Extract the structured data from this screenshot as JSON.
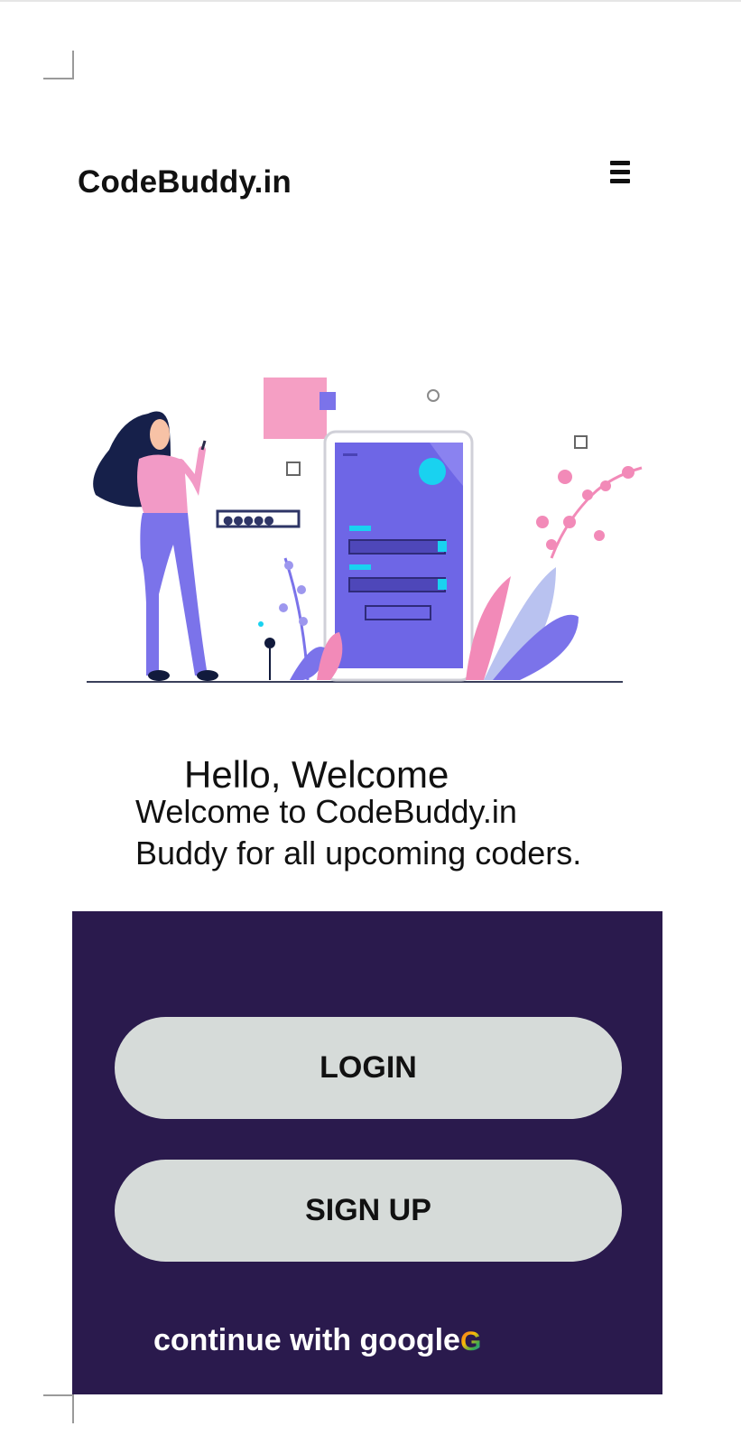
{
  "header": {
    "brand": "CodeBuddy.in",
    "menu_icon": "hamburger-menu-icon"
  },
  "hero": {
    "illustration": "woman-with-phone-login-illustration",
    "password_dots": "●●●●●"
  },
  "welcome": {
    "title": "Hello, Welcome",
    "line1": "Welcome to CodeBuddy.in",
    "line2": "Buddy for all upcoming coders."
  },
  "auth": {
    "login_label": "LOGIN",
    "signup_label": "SIGN UP",
    "google_text": "continue with google",
    "google_icon_letter": "G"
  },
  "colors": {
    "panel_bg": "#2a1a4d",
    "button_bg": "#d6dbd9",
    "phone_screen": "#6e66e6",
    "accent_pink": "#f29ac6",
    "accent_cyan": "#19d2f0"
  }
}
